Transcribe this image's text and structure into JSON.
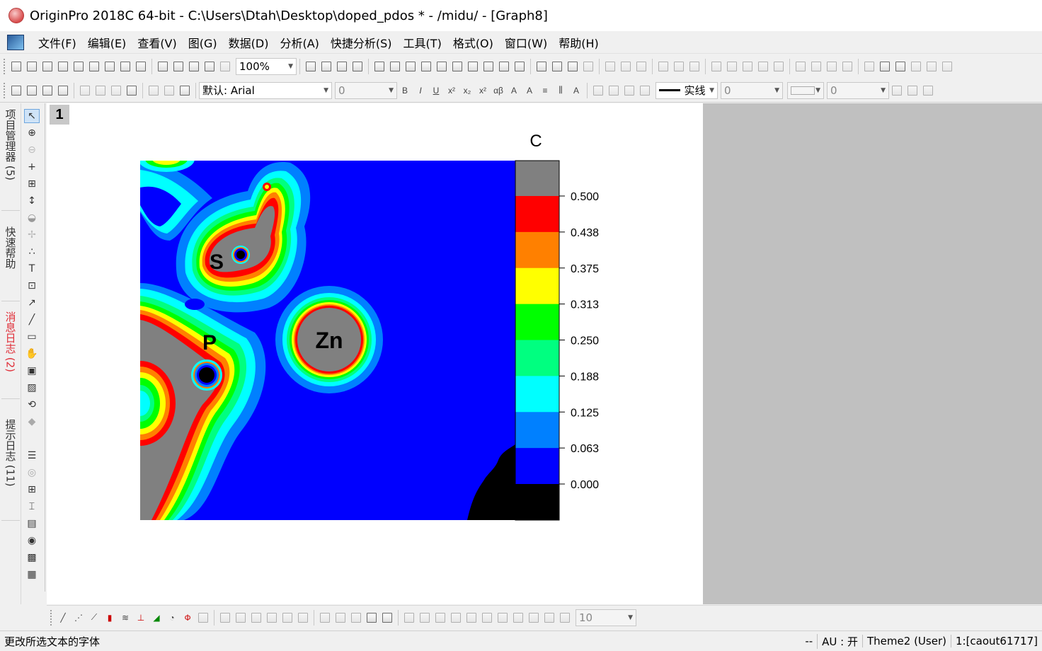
{
  "window": {
    "title": "OriginPro 2018C 64-bit - C:\\Users\\Dtah\\Desktop\\doped_pdos * - /midu/ - [Graph8]"
  },
  "menu": {
    "items": [
      "文件(F)",
      "编辑(E)",
      "查看(V)",
      "图(G)",
      "数据(D)",
      "分析(A)",
      "快捷分析(S)",
      "工具(T)",
      "格式(O)",
      "窗口(W)",
      "帮助(H)"
    ]
  },
  "toolbar": {
    "zoom": "100%",
    "font_name": "默认: Arial",
    "font_size": "0",
    "line_style": "实线",
    "line_width": "0",
    "pattern_width": "0",
    "bottom_size": "10"
  },
  "side_tabs": {
    "project_explorer": "项目管理器 (5)",
    "quick_help": "快速帮助",
    "message_log": "消息日志 (2)",
    "hint_log": "提示日志 (11)"
  },
  "graph": {
    "layer_label": "1",
    "atom_labels": [
      "S",
      "P",
      "Zn"
    ]
  },
  "chart_data": {
    "type": "heatmap",
    "colorbar_title": "C",
    "levels": [
      0.0,
      0.063,
      0.125,
      0.188,
      0.25,
      0.313,
      0.375,
      0.438,
      0.5
    ],
    "tick_labels": [
      "0.500",
      "0.438",
      "0.375",
      "0.313",
      "0.250",
      "0.188",
      "0.125",
      "0.063",
      "0.000"
    ],
    "colors": [
      "#000000",
      "#0000ff",
      "#0080ff",
      "#00ffff",
      "#00ff80",
      "#00ff00",
      "#ffff00",
      "#ff8000",
      "#ff0000",
      "#808080"
    ]
  },
  "status": {
    "hint": "更改所选文本的字体",
    "dashes": "--",
    "au": "AU : 开",
    "theme": "Theme2 (User)",
    "cell": "1:[caout61717]"
  }
}
